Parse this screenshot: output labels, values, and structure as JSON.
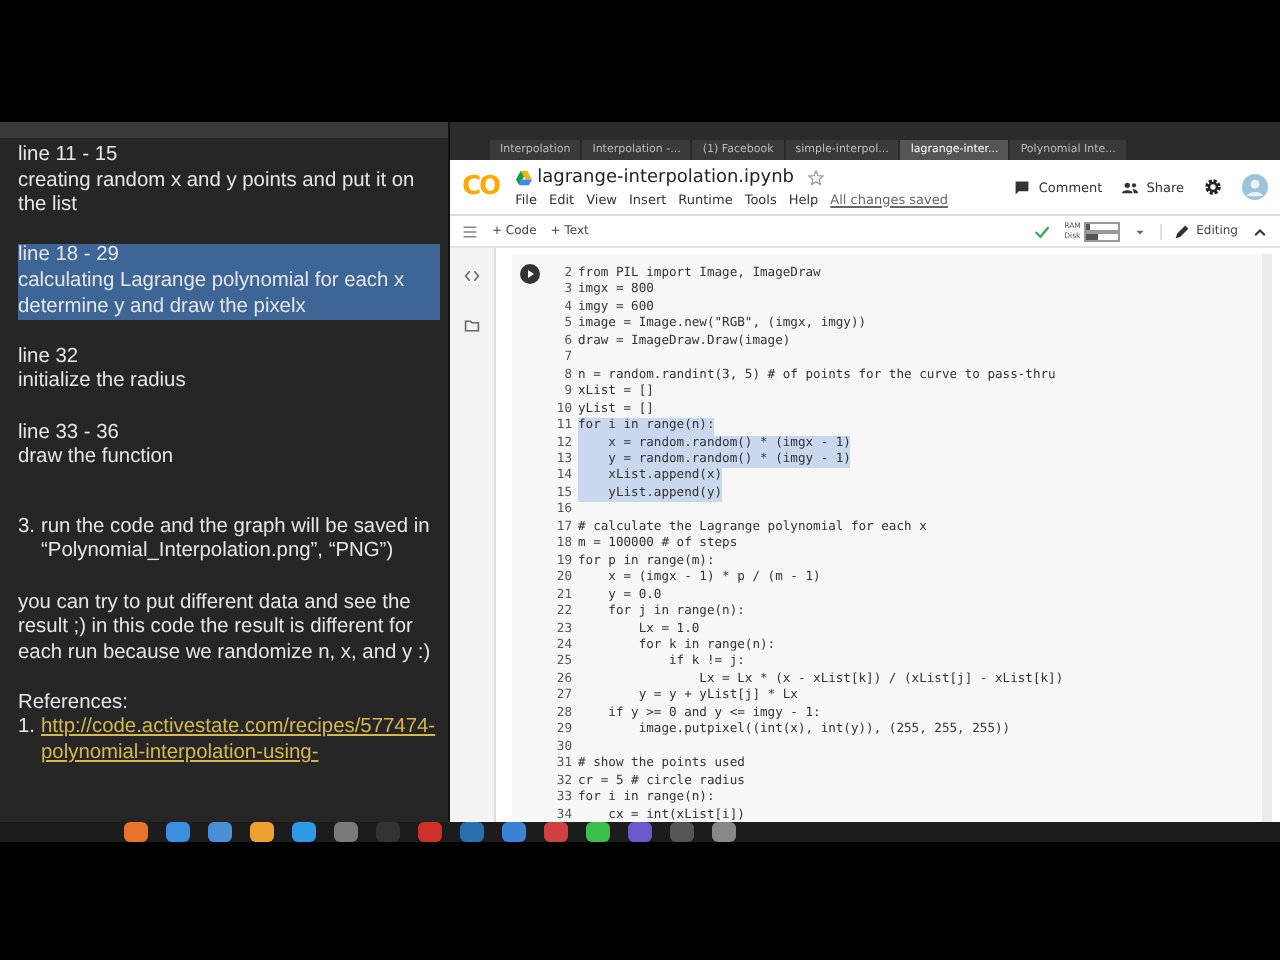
{
  "notes": [
    {
      "heading": "line 11 - 15",
      "text": "creating random x and y points and put it on the list",
      "selected": false
    },
    {
      "heading": "line 18 - 29",
      "text": "calculating Lagrange polynomial for each x determine y and draw the pixelx",
      "selected": true
    },
    {
      "heading": "line 32",
      "text": "initialize the radius",
      "selected": false
    },
    {
      "heading": "line 33 - 36",
      "text": "draw the function",
      "selected": false
    }
  ],
  "instruction": {
    "number": "3.",
    "text": "run the code and the graph will be saved in “Polynomial_Interpolation.png”, “PNG”)"
  },
  "remark": "you can try to put different data and see the result ;) in this code the result is different for each run because we randomize n, x, and y :)",
  "references": {
    "heading": "References:",
    "items": [
      {
        "number": "1.",
        "link": "http://code.activestate.com/recipes/577474-polynomial-interpolation-using-"
      }
    ]
  },
  "browser_tabs": [
    {
      "label": "Interpolation",
      "selected": false
    },
    {
      "label": "Interpolation -...",
      "selected": false
    },
    {
      "label": "(1) Facebook",
      "selected": false
    },
    {
      "label": "simple-interpol...",
      "selected": false
    },
    {
      "label": "lagrange-inter...",
      "selected": true
    },
    {
      "label": "Polynomial Inte...",
      "selected": false
    }
  ],
  "colab": {
    "logo": "CO",
    "filename": "lagrange-interpolation.ipynb",
    "menu": [
      "File",
      "Edit",
      "View",
      "Insert",
      "Runtime",
      "Tools",
      "Help"
    ],
    "save_status": "All changes saved",
    "comment": "Comment",
    "share": "Share",
    "toolbar": {
      "add_code": "+ Code",
      "add_text": "+ Text",
      "ram": {
        "label": "RAM",
        "level": 0.1
      },
      "disk": {
        "label": "Disk",
        "level": 0.35
      },
      "mode": "Editing"
    }
  },
  "code_lines": [
    {
      "number": "2",
      "text": "from PIL import Image, ImageDraw",
      "selected": false
    },
    {
      "number": "3",
      "text": "imgx = 800",
      "selected": false
    },
    {
      "number": "4",
      "text": "imgy = 600",
      "selected": false
    },
    {
      "number": "5",
      "text": "image = Image.new(\"RGB\", (imgx, imgy))",
      "selected": false
    },
    {
      "number": "6",
      "text": "draw = ImageDraw.Draw(image)",
      "selected": false
    },
    {
      "number": "7"
    },
    {
      "number": "8",
      "text": "n = random.randint(3, 5) # of points for the curve to pass-thru",
      "selected": false
    },
    {
      "number": "9",
      "text": "xList = []",
      "selected": false
    },
    {
      "number": "10",
      "text": "yList = []",
      "selected": false
    },
    {
      "number": "11",
      "text": "for i in range(n):",
      "selected": true
    },
    {
      "number": "12",
      "text": "    x = random.random() * (imgx - 1)",
      "selected": true
    },
    {
      "number": "13",
      "text": "    y = random.random() * (imgy - 1)",
      "selected": true
    },
    {
      "number": "14",
      "text": "    xList.append(x)",
      "selected": true
    },
    {
      "number": "15",
      "text": "    yList.append(y)",
      "selected": true
    },
    {
      "number": "16"
    },
    {
      "number": "17",
      "text": "# calculate the Lagrange polynomial for each x",
      "selected": false
    },
    {
      "number": "18",
      "text": "m = 100000 # of steps",
      "selected": false
    },
    {
      "number": "19",
      "text": "for p in range(m):",
      "selected": false
    },
    {
      "number": "20",
      "text": "    x = (imgx - 1) * p / (m - 1)",
      "selected": false
    },
    {
      "number": "21",
      "text": "    y = 0.0",
      "selected": false
    },
    {
      "number": "22",
      "text": "    for j in range(n):",
      "selected": false
    },
    {
      "number": "23",
      "text": "        Lx = 1.0",
      "selected": false
    },
    {
      "number": "24",
      "text": "        for k in range(n):",
      "selected": false
    },
    {
      "number": "25",
      "text": "            if k != j:",
      "selected": false
    },
    {
      "number": "26",
      "text": "                Lx = Lx * (x - xList[k]) / (xList[j] - xList[k])",
      "selected": false
    },
    {
      "number": "27",
      "text": "        y = y + yList[j] * Lx",
      "selected": false
    },
    {
      "number": "28",
      "text": "    if y >= 0 and y <= imgy - 1:",
      "selected": false
    },
    {
      "number": "29",
      "text": "        image.putpixel((int(x), int(y)), (255, 255, 255))",
      "selected": false
    },
    {
      "number": "30"
    },
    {
      "number": "31",
      "text": "# show the points used",
      "selected": false
    },
    {
      "number": "32",
      "text": "cr = 5 # circle radius",
      "selected": false
    },
    {
      "number": "33",
      "text": "for i in range(n):",
      "selected": false
    },
    {
      "number": "34",
      "text": "    cx = int(xList[i])",
      "selected": false
    }
  ],
  "dock": [
    {
      "color": "#e8732c"
    },
    {
      "color": "#3a8fe0"
    },
    {
      "color": "#4a90d9"
    },
    {
      "color": "#f0a030"
    },
    {
      "color": "#2f9be8"
    },
    {
      "color": "#7a7a7a"
    },
    {
      "color": "#333333"
    },
    {
      "color": "#d0302a"
    },
    {
      "color": "#2a6fb0"
    },
    {
      "color": "#3b82d6"
    },
    {
      "color": "#d04040"
    },
    {
      "color": "#3cbf4a"
    },
    {
      "color": "#6a5acd"
    },
    {
      "color": "#555555"
    },
    {
      "color": "#888888"
    }
  ]
}
